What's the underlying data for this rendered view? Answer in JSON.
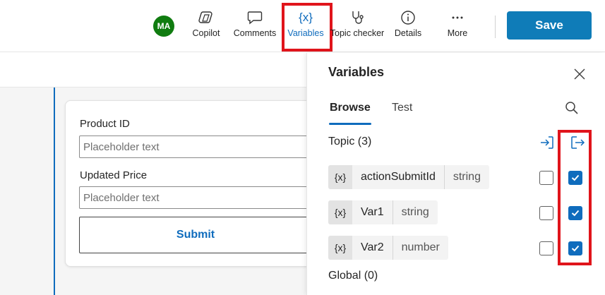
{
  "toolbar": {
    "avatar_initials": "MA",
    "buttons": [
      {
        "label": "Copilot",
        "icon": "copilot-icon"
      },
      {
        "label": "Comments",
        "icon": "comment-icon"
      },
      {
        "label": "Variables",
        "icon": "variables-icon"
      },
      {
        "label": "Topic checker",
        "icon": "stethoscope-icon"
      },
      {
        "label": "Details",
        "icon": "info-icon"
      },
      {
        "label": "More",
        "icon": "more-icon"
      }
    ],
    "save_label": "Save"
  },
  "form_card": {
    "fields": [
      {
        "label": "Product ID",
        "placeholder": "Placeholder text"
      },
      {
        "label": "Updated Price",
        "placeholder": "Placeholder text"
      }
    ],
    "submit_label": "Submit"
  },
  "panel": {
    "title": "Variables",
    "tabs": [
      {
        "label": "Browse"
      },
      {
        "label": "Test"
      }
    ],
    "topic_section": "Topic (3)",
    "global_section": "Global (0)",
    "variable_badge": "{x}",
    "variables": [
      {
        "name": "actionSubmitId",
        "type": "string",
        "input": false,
        "output": true
      },
      {
        "name": "Var1",
        "type": "string",
        "input": false,
        "output": true
      },
      {
        "name": "Var2",
        "type": "number",
        "input": false,
        "output": true
      }
    ]
  },
  "colors": {
    "accent": "#0f6cbd",
    "save_button": "#0f7cb8",
    "avatar": "#107c10",
    "highlight": "#e0141b"
  }
}
